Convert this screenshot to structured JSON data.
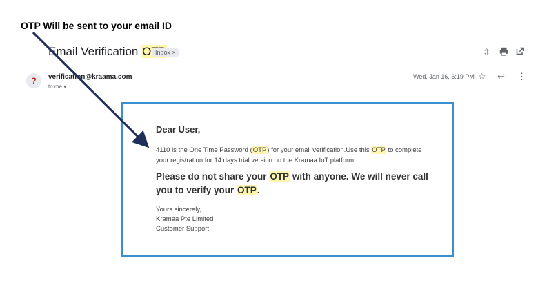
{
  "annotation": "OTP Will be sent to your email ID",
  "email": {
    "subject_prefix": "Email Verification ",
    "subject_highlight": "OTP",
    "label_badge": "Inbox ×",
    "sender": "verification@kraama.com",
    "to": "to me ▾",
    "date": "Wed, Jan 16, 6:19 PM",
    "avatar_letter": "?"
  },
  "body": {
    "greeting": "Dear User,",
    "line_a": "4110 is the One Time Password (",
    "otp1": "OTP",
    "line_b": ") for your email verification.Use this ",
    "otp2": "OTP",
    "line_c": " to complete your registration for 14 days trial version on the Kramaa IoT platform.",
    "warn_a": "Please do not share your ",
    "warn_otp1": "OTP",
    "warn_b": " with anyone. We will never call you to verify your ",
    "warn_otp2": "OTP",
    "warn_c": ".",
    "sign1": "Yours sincerely,",
    "sign2": "Kramaa Pte Limited",
    "sign3": "Customer Support"
  },
  "icons": {
    "collapse": "collapse-icon",
    "print": "print-icon",
    "open": "open-new-window-icon",
    "star": "star-icon",
    "reply": "reply-icon",
    "more": "more-vert-icon"
  },
  "colors": {
    "highlight": "#fff6b0",
    "border": "#3a8fd0",
    "arrow": "#1f2f5a"
  }
}
